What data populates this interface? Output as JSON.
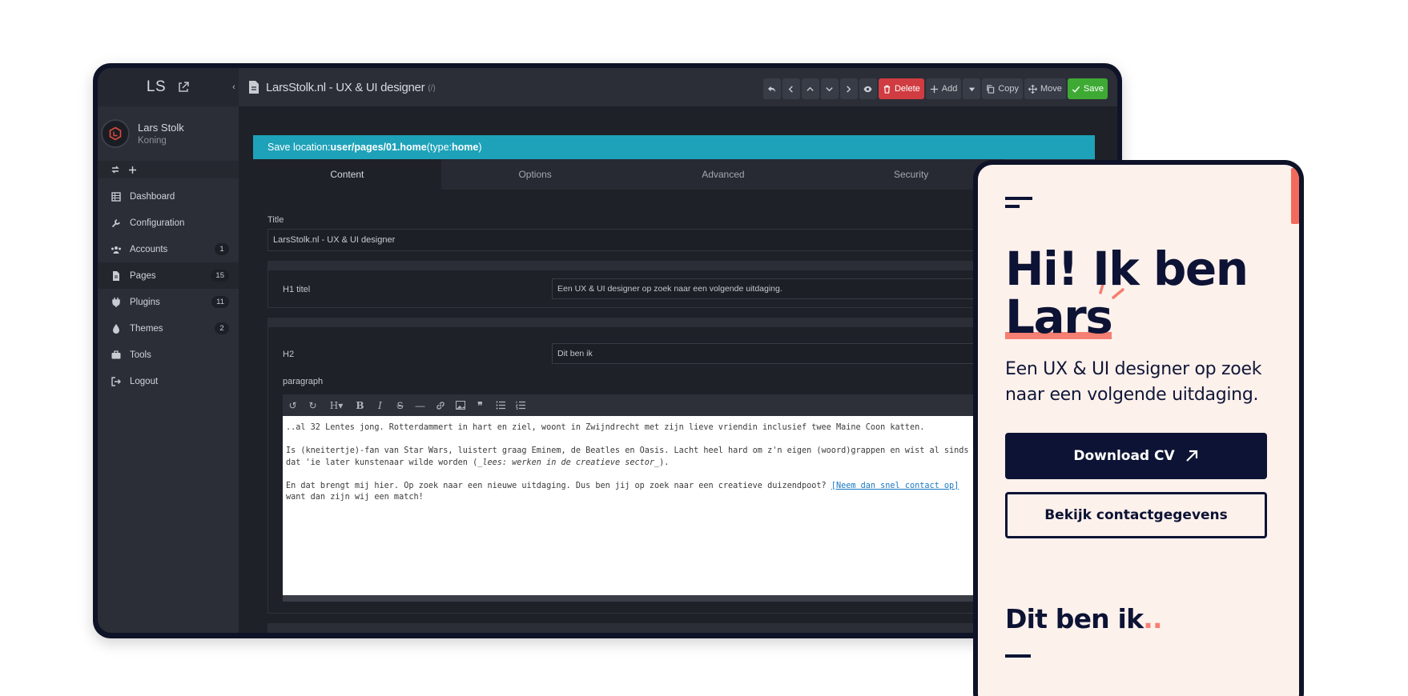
{
  "admin": {
    "logo": "LS",
    "user": {
      "name": "Lars Stolk",
      "role": "Koning"
    },
    "nav": [
      {
        "label": "Dashboard",
        "icon": "dashboard-icon",
        "badge": ""
      },
      {
        "label": "Configuration",
        "icon": "wrench-icon",
        "badge": ""
      },
      {
        "label": "Accounts",
        "icon": "users-icon",
        "badge": "1"
      },
      {
        "label": "Pages",
        "icon": "file-icon",
        "badge": "15"
      },
      {
        "label": "Plugins",
        "icon": "plug-icon",
        "badge": "11"
      },
      {
        "label": "Themes",
        "icon": "drop-icon",
        "badge": "2"
      },
      {
        "label": "Tools",
        "icon": "briefcase-icon",
        "badge": ""
      },
      {
        "label": "Logout",
        "icon": "logout-icon",
        "badge": ""
      }
    ],
    "page_title": "LarsStolk.nl - UX & UI designer",
    "page_route": "(/)",
    "toolbar": {
      "delete": "Delete",
      "add": "Add",
      "copy": "Copy",
      "move": "Move",
      "save": "Save"
    },
    "save_location": {
      "prefix": "Save location: ",
      "path": "user/pages/01.home",
      "type_prefix": " (type: ",
      "type": "home",
      "type_suffix": ")"
    },
    "tabs": [
      "Content",
      "Options",
      "Advanced",
      "Security"
    ],
    "form": {
      "title_label": "Title",
      "title_value": "LarsStolk.nl - UX & UI designer",
      "h1_label": "H1 titel",
      "h1_value": "Een UX & UI designer op zoek naar een volgende uitdaging.",
      "h2_label": "H2",
      "h2_value": "Dit ben ik",
      "paragraph_label": "paragraph",
      "editor": {
        "line1": "..al 32 Lentes jong. Rotterdammert in hart en ziel, woont in Zwijndrecht met zijn lieve vriendin inclusief twee Maine Coon katten.",
        "line2": "Is (kneitertje)-fan van Star Wars, luistert graag Eminem, de Beatles en Oasis. Lacht heel hard om z'n eigen (woord)grappen en wist al sinds",
        "line3a": "dat 'ie later kunstenaar wilde worden (",
        "line3em": "_lees: werken in de creatieve sector_",
        "line3b": ").",
        "line4a": "En dat brengt mij hier. Op zoek naar een nieuwe uitdaging. Dus ben jij op zoek naar een creatieve duizendpoot? ",
        "line4link": "[Neem dan snel contact op]",
        "line5": "want dan zijn wij een match!"
      }
    }
  },
  "mobile": {
    "hero_line1": "Hi! Ik ben",
    "hero_line2": "Lars",
    "tagline": "Een UX & UI designer op zoek naar een volgende uitdaging.",
    "download_button": "Download CV",
    "contact_button": "Bekijk contactgegevens",
    "section_title": "Dit ben ik",
    "section_dots": "..",
    "accent_color": "#f47f72",
    "navy_color": "#0d1334"
  }
}
